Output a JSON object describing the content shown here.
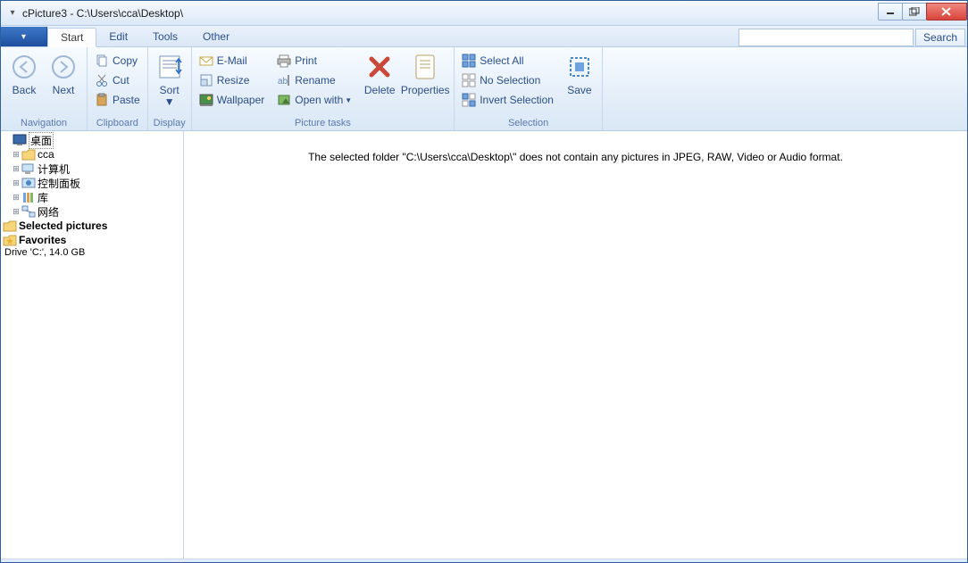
{
  "window": {
    "title": "cPicture3 - C:\\Users\\cca\\Desktop\\"
  },
  "tabs": {
    "file_dropdown": "▾",
    "start": "Start",
    "edit": "Edit",
    "tools": "Tools",
    "other": "Other",
    "search_btn": "Search"
  },
  "ribbon": {
    "nav": {
      "back": "Back",
      "next": "Next",
      "label": "Navigation"
    },
    "clipboard": {
      "copy": "Copy",
      "cut": "Cut",
      "paste": "Paste",
      "label": "Clipboard"
    },
    "display": {
      "sort": "Sort",
      "label": "Display"
    },
    "picture": {
      "email": "E-Mail",
      "resize": "Resize",
      "wallpaper": "Wallpaper",
      "print": "Print",
      "rename": "Rename",
      "openwith": "Open with",
      "delete": "Delete",
      "properties": "Properties",
      "label": "Picture tasks"
    },
    "selection": {
      "selectall": "Select All",
      "noselection": "No Selection",
      "invert": "Invert Selection",
      "save": "Save",
      "label": "Selection"
    }
  },
  "tree": {
    "desktop": "桌面",
    "cca": "cca",
    "computer": "计算机",
    "controlpanel": "控制面板",
    "libraries": "库",
    "network": "网络",
    "selected": "Selected pictures",
    "favorites": "Favorites",
    "drive": "Drive 'C:', 14.0 GB"
  },
  "content": {
    "empty": "The selected folder \"C:\\Users\\cca\\Desktop\\\" does not contain any pictures in JPEG, RAW, Video or Audio format."
  }
}
